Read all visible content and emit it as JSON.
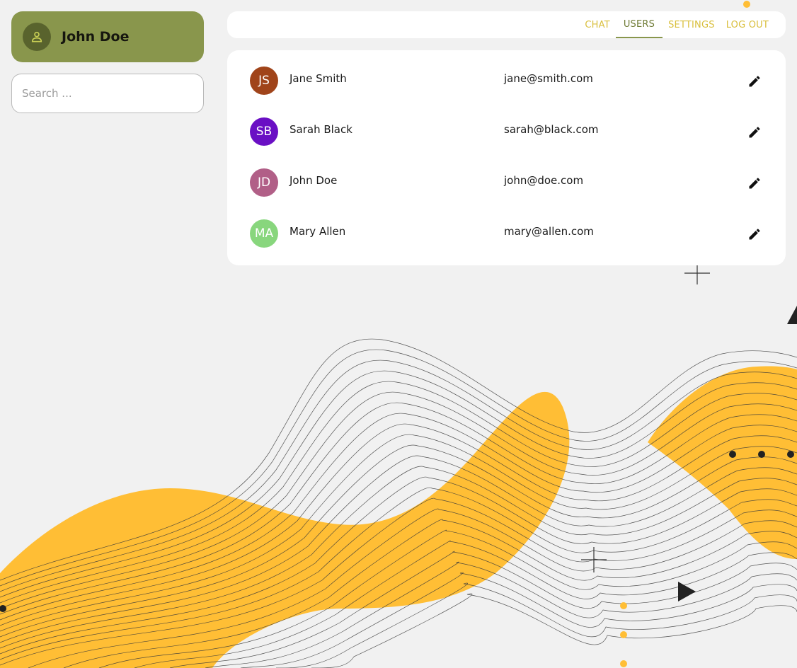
{
  "profile": {
    "name": "John Doe",
    "avatar_icon": "person-icon"
  },
  "search": {
    "placeholder": "Search ...",
    "value": ""
  },
  "nav": {
    "tabs": [
      {
        "label": "CHAT"
      },
      {
        "label": "USERS"
      },
      {
        "label": "SETTINGS"
      },
      {
        "label": "LOG OUT"
      }
    ],
    "active_tab": "USERS"
  },
  "users": [
    {
      "initials": "JS",
      "name": "Jane Smith",
      "email": "jane@smith.com",
      "color": "#a0441a"
    },
    {
      "initials": "SB",
      "name": "Sarah Black",
      "email": "sarah@black.com",
      "color": "#6a0fc4"
    },
    {
      "initials": "JD",
      "name": "John Doe",
      "email": "john@doe.com",
      "color": "#b15f87"
    },
    {
      "initials": "MA",
      "name": "Mary Allen",
      "email": "mary@allen.com",
      "color": "#88d67d"
    }
  ],
  "icons": {
    "edit": "pencil-icon"
  },
  "colors": {
    "profile_bg": "#89964c",
    "accent_yellow": "#d9bf3c",
    "active_tab": "#6f7b35",
    "wave_orange": "#ffbe35"
  }
}
